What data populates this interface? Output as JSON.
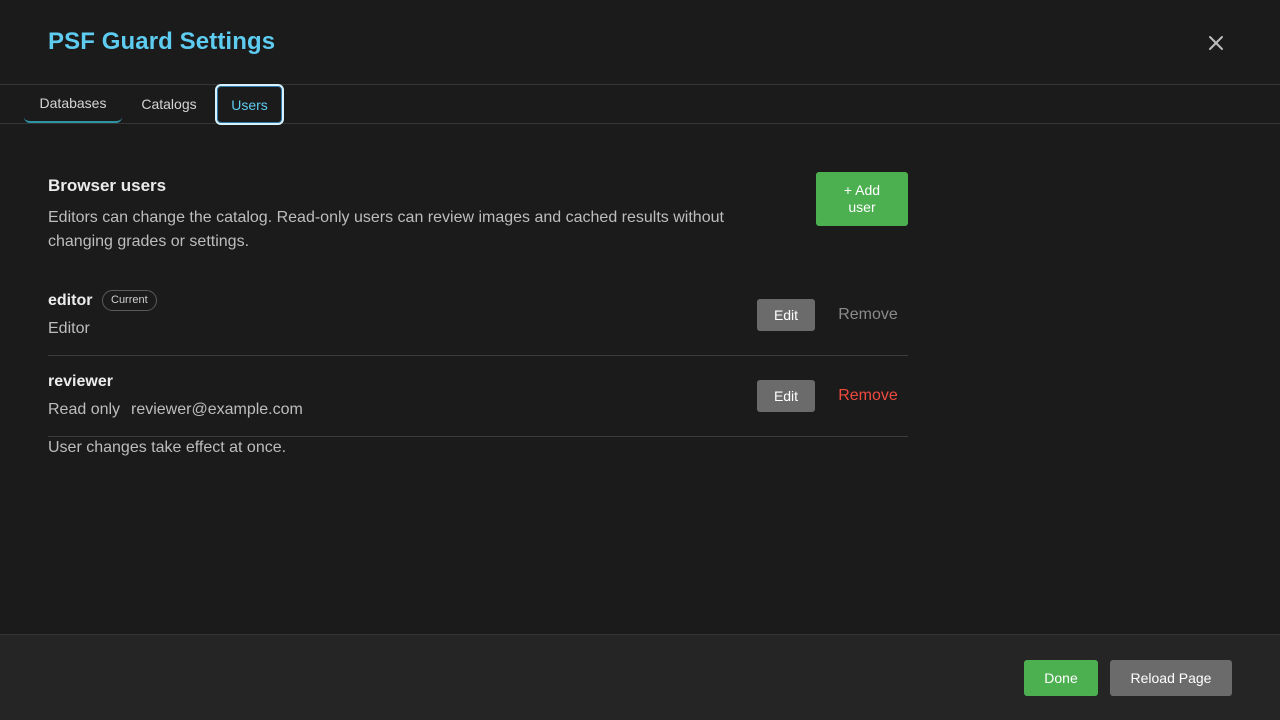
{
  "dialog": {
    "title": "PSF Guard Settings"
  },
  "icons": {
    "close": "close-icon"
  },
  "tabs": [
    {
      "label": "Databases"
    },
    {
      "label": "Catalogs"
    },
    {
      "label": "Users",
      "active": true
    }
  ],
  "users_section": {
    "title": "Browser users",
    "description": "Editors can change the catalog. Read-only users can review images and cached results without changing grades or settings.",
    "add_button": "+ Add user",
    "users": [
      {
        "name": "editor",
        "badge": "Current",
        "role": "Editor",
        "email": "",
        "edit_label": "Edit",
        "remove_label": "Remove",
        "remove_enabled": false
      },
      {
        "name": "reviewer",
        "badge": "",
        "role": "Read only",
        "email": "reviewer@example.com",
        "edit_label": "Edit",
        "remove_label": "Remove",
        "remove_enabled": true
      }
    ],
    "footnote": "User changes take effect at once."
  },
  "footer": {
    "done_label": "Done",
    "reload_label": "Reload Page"
  },
  "colors": {
    "accent": "#5ecbf0",
    "primary_button": "#4caf50",
    "secondary_button": "#6b6b6b",
    "danger": "#f04a3f",
    "background": "#1b1b1b"
  }
}
